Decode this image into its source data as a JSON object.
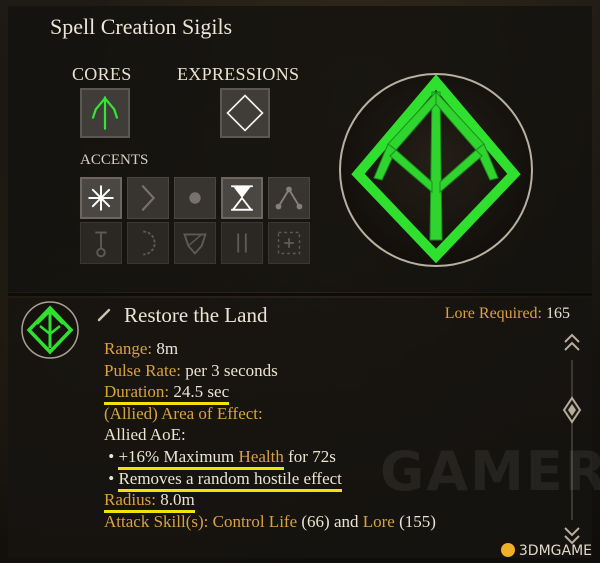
{
  "header": {
    "title": "Spell Creation Sigils"
  },
  "cores": {
    "label": "CORES"
  },
  "expressions": {
    "label": "EXPRESSIONS"
  },
  "accents": {
    "label": "ACCENTS",
    "icons": [
      "asterisk-icon",
      "chevron-right-icon",
      "dot-icon",
      "hourglass-icon",
      "triangle-dots-icon",
      "staff-icon",
      "crescent-icon",
      "shield-icon",
      "double-bar-icon",
      "plus-box-icon"
    ]
  },
  "spell": {
    "name": "Restore the Land",
    "lore_label": "Lore Required:",
    "lore_value": "165",
    "range_label": "Range:",
    "range_value": "8m",
    "pulse_label": "Pulse Rate:",
    "pulse_value": "per 3 seconds",
    "duration_label": "Duration:",
    "duration_value": "24.5 sec",
    "aoe_header": "(Allied) Area of Effect:",
    "allied_aoe": "Allied AoE:",
    "effect1_prefix": "+16% Maximum",
    "effect1_health": "Health",
    "effect1_suffix": "for 72s",
    "effect2": "Removes a random hostile effect",
    "radius_label": "Radius:",
    "radius_value": "8.0m",
    "attack_label": "Attack Skill(s):",
    "skill1": "Control Life",
    "skill1_value": "(66)",
    "and": "and",
    "skill2": "Lore",
    "skill2_value": "(155)"
  },
  "watermark": "GAMERSKY",
  "logo": "3DMGAME",
  "colors": {
    "accent": "#d9a23e",
    "sigil": "#2ee62e",
    "highlight": "#f3e20a"
  }
}
